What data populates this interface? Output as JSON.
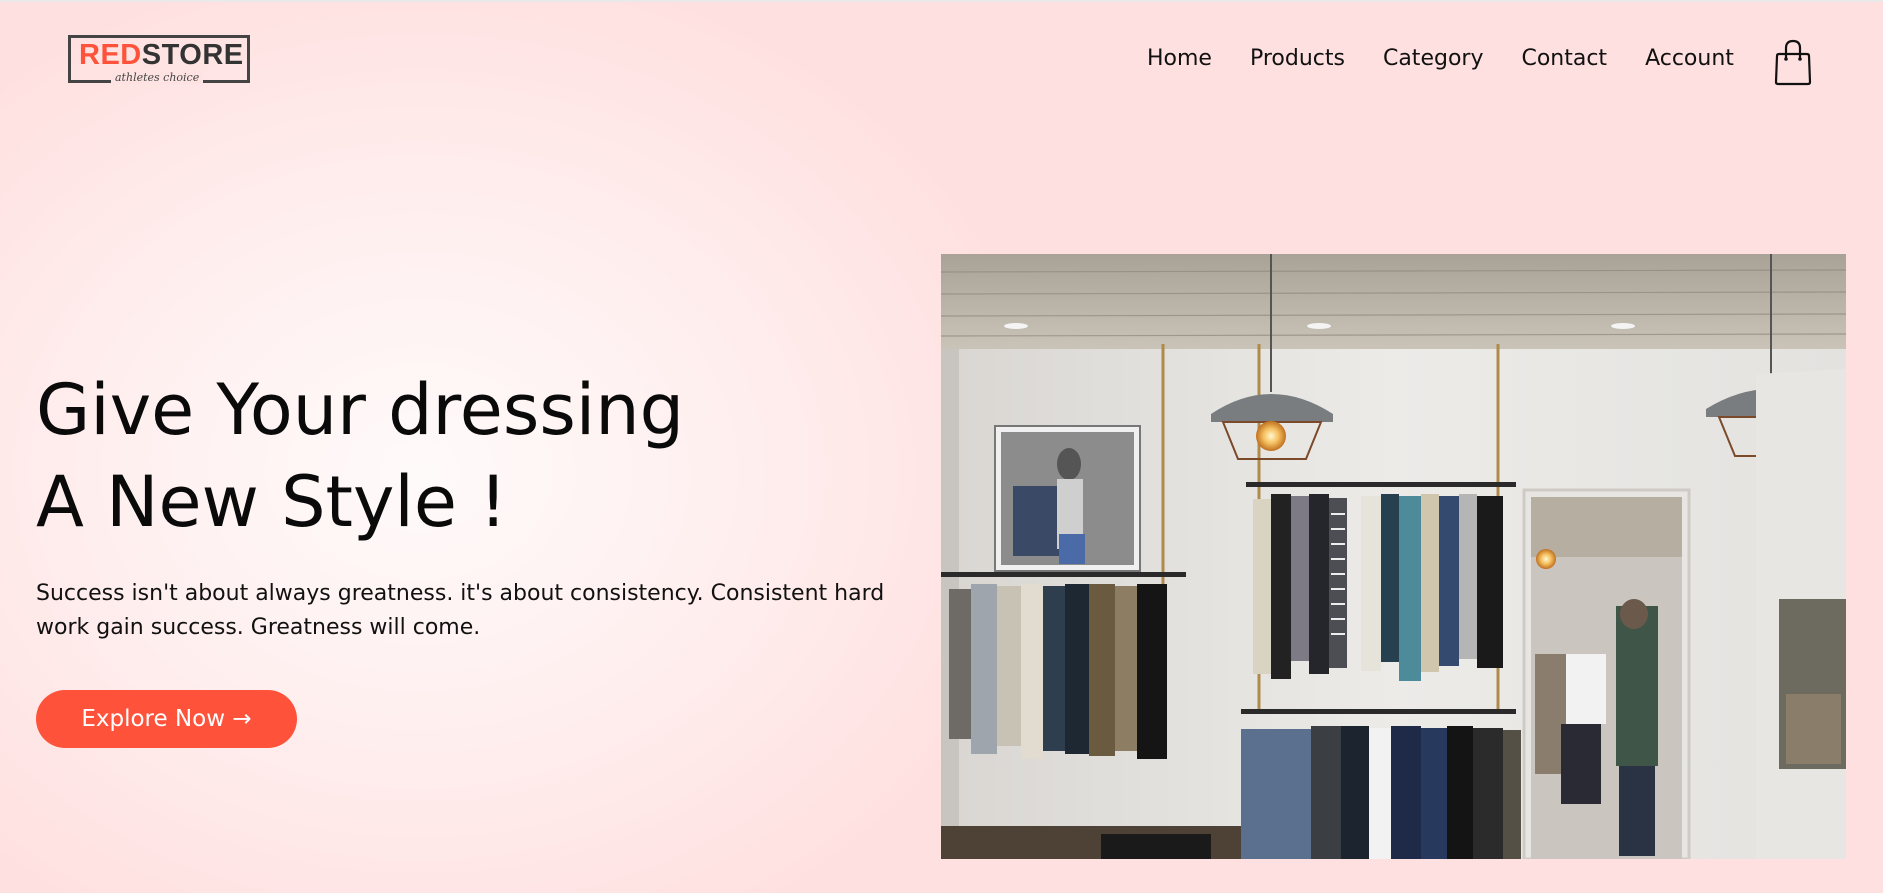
{
  "brand": {
    "logo_red": "RED",
    "logo_dark": "STORE",
    "tagline": "athletes choice",
    "accent_color": "#ff523b"
  },
  "nav": {
    "items": [
      {
        "label": "Home"
      },
      {
        "label": "Products"
      },
      {
        "label": "Category"
      },
      {
        "label": "Contact"
      },
      {
        "label": "Account"
      }
    ],
    "cart_icon": "shopping-bag-icon"
  },
  "hero": {
    "title_line1": "Give Your dressing",
    "title_line2": "A New Style !",
    "text": "Success isn't about always greatness. it's about consistency. Consistent hard work gain success. Greatness will come.",
    "button_label": "Explore Now →"
  }
}
